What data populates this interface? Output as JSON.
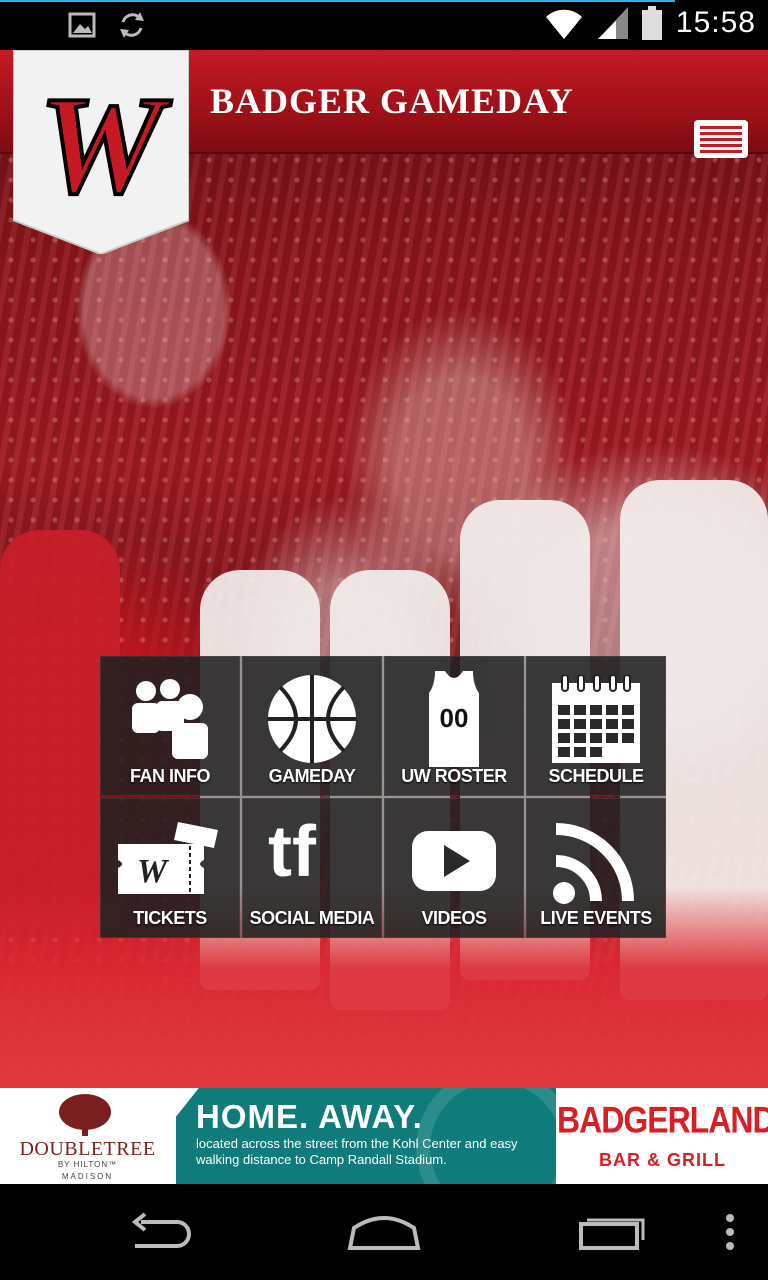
{
  "status_bar": {
    "time": "15:58",
    "icons": [
      "image-icon",
      "sync-icon",
      "wifi-icon",
      "signal-icon",
      "battery-icon"
    ]
  },
  "header": {
    "title": "BADGER GAMEDAY",
    "logo": "W",
    "menu_icon": "list-icon"
  },
  "tiles": [
    {
      "label": "FAN INFO",
      "icon": "users-icon"
    },
    {
      "label": "GAMEDAY",
      "icon": "basketball-icon"
    },
    {
      "label": "UW ROSTER",
      "icon": "jersey-icon",
      "jersey_number": "00"
    },
    {
      "label": "SCHEDULE",
      "icon": "calendar-icon"
    },
    {
      "label": "TICKETS",
      "icon": "ticket-icon",
      "ticket_logo": "W"
    },
    {
      "label": "SOCIAL MEDIA",
      "icon": "social-icon",
      "social_letters": "tf"
    },
    {
      "label": "VIDEOS",
      "icon": "play-icon"
    },
    {
      "label": "LIVE EVENTS",
      "icon": "rss-icon"
    }
  ],
  "ad": {
    "left_brand": "DOUBLETREE",
    "left_sub": "BY HILTON™",
    "left_city": "MADISON",
    "headline": "HOME. AWAY.",
    "copy": "located across the street from the Kohl Center and easy walking distance to Camp Randall Stadium.",
    "right_brand": "BADGERLAND",
    "right_sub": "BAR & GRILL"
  },
  "navbar": {
    "buttons": [
      "back-icon",
      "home-icon",
      "recent-apps-icon",
      "overflow-menu-icon"
    ]
  },
  "colors": {
    "accent": "#c51a24",
    "teal": "#0f7c7b",
    "status_line": "#33b5e5"
  }
}
